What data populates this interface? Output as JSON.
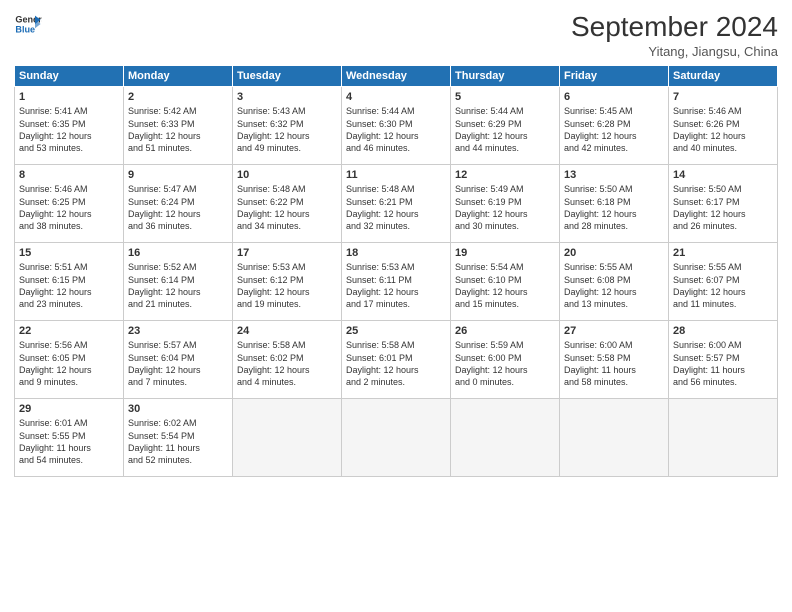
{
  "header": {
    "logo_line1": "General",
    "logo_line2": "Blue",
    "month": "September 2024",
    "location": "Yitang, Jiangsu, China"
  },
  "days_of_week": [
    "Sunday",
    "Monday",
    "Tuesday",
    "Wednesday",
    "Thursday",
    "Friday",
    "Saturday"
  ],
  "weeks": [
    [
      {
        "day": "1",
        "lines": [
          "Sunrise: 5:41 AM",
          "Sunset: 6:35 PM",
          "Daylight: 12 hours",
          "and 53 minutes."
        ]
      },
      {
        "day": "2",
        "lines": [
          "Sunrise: 5:42 AM",
          "Sunset: 6:33 PM",
          "Daylight: 12 hours",
          "and 51 minutes."
        ]
      },
      {
        "day": "3",
        "lines": [
          "Sunrise: 5:43 AM",
          "Sunset: 6:32 PM",
          "Daylight: 12 hours",
          "and 49 minutes."
        ]
      },
      {
        "day": "4",
        "lines": [
          "Sunrise: 5:44 AM",
          "Sunset: 6:30 PM",
          "Daylight: 12 hours",
          "and 46 minutes."
        ]
      },
      {
        "day": "5",
        "lines": [
          "Sunrise: 5:44 AM",
          "Sunset: 6:29 PM",
          "Daylight: 12 hours",
          "and 44 minutes."
        ]
      },
      {
        "day": "6",
        "lines": [
          "Sunrise: 5:45 AM",
          "Sunset: 6:28 PM",
          "Daylight: 12 hours",
          "and 42 minutes."
        ]
      },
      {
        "day": "7",
        "lines": [
          "Sunrise: 5:46 AM",
          "Sunset: 6:26 PM",
          "Daylight: 12 hours",
          "and 40 minutes."
        ]
      }
    ],
    [
      {
        "day": "8",
        "lines": [
          "Sunrise: 5:46 AM",
          "Sunset: 6:25 PM",
          "Daylight: 12 hours",
          "and 38 minutes."
        ]
      },
      {
        "day": "9",
        "lines": [
          "Sunrise: 5:47 AM",
          "Sunset: 6:24 PM",
          "Daylight: 12 hours",
          "and 36 minutes."
        ]
      },
      {
        "day": "10",
        "lines": [
          "Sunrise: 5:48 AM",
          "Sunset: 6:22 PM",
          "Daylight: 12 hours",
          "and 34 minutes."
        ]
      },
      {
        "day": "11",
        "lines": [
          "Sunrise: 5:48 AM",
          "Sunset: 6:21 PM",
          "Daylight: 12 hours",
          "and 32 minutes."
        ]
      },
      {
        "day": "12",
        "lines": [
          "Sunrise: 5:49 AM",
          "Sunset: 6:19 PM",
          "Daylight: 12 hours",
          "and 30 minutes."
        ]
      },
      {
        "day": "13",
        "lines": [
          "Sunrise: 5:50 AM",
          "Sunset: 6:18 PM",
          "Daylight: 12 hours",
          "and 28 minutes."
        ]
      },
      {
        "day": "14",
        "lines": [
          "Sunrise: 5:50 AM",
          "Sunset: 6:17 PM",
          "Daylight: 12 hours",
          "and 26 minutes."
        ]
      }
    ],
    [
      {
        "day": "15",
        "lines": [
          "Sunrise: 5:51 AM",
          "Sunset: 6:15 PM",
          "Daylight: 12 hours",
          "and 23 minutes."
        ]
      },
      {
        "day": "16",
        "lines": [
          "Sunrise: 5:52 AM",
          "Sunset: 6:14 PM",
          "Daylight: 12 hours",
          "and 21 minutes."
        ]
      },
      {
        "day": "17",
        "lines": [
          "Sunrise: 5:53 AM",
          "Sunset: 6:12 PM",
          "Daylight: 12 hours",
          "and 19 minutes."
        ]
      },
      {
        "day": "18",
        "lines": [
          "Sunrise: 5:53 AM",
          "Sunset: 6:11 PM",
          "Daylight: 12 hours",
          "and 17 minutes."
        ]
      },
      {
        "day": "19",
        "lines": [
          "Sunrise: 5:54 AM",
          "Sunset: 6:10 PM",
          "Daylight: 12 hours",
          "and 15 minutes."
        ]
      },
      {
        "day": "20",
        "lines": [
          "Sunrise: 5:55 AM",
          "Sunset: 6:08 PM",
          "Daylight: 12 hours",
          "and 13 minutes."
        ]
      },
      {
        "day": "21",
        "lines": [
          "Sunrise: 5:55 AM",
          "Sunset: 6:07 PM",
          "Daylight: 12 hours",
          "and 11 minutes."
        ]
      }
    ],
    [
      {
        "day": "22",
        "lines": [
          "Sunrise: 5:56 AM",
          "Sunset: 6:05 PM",
          "Daylight: 12 hours",
          "and 9 minutes."
        ]
      },
      {
        "day": "23",
        "lines": [
          "Sunrise: 5:57 AM",
          "Sunset: 6:04 PM",
          "Daylight: 12 hours",
          "and 7 minutes."
        ]
      },
      {
        "day": "24",
        "lines": [
          "Sunrise: 5:58 AM",
          "Sunset: 6:02 PM",
          "Daylight: 12 hours",
          "and 4 minutes."
        ]
      },
      {
        "day": "25",
        "lines": [
          "Sunrise: 5:58 AM",
          "Sunset: 6:01 PM",
          "Daylight: 12 hours",
          "and 2 minutes."
        ]
      },
      {
        "day": "26",
        "lines": [
          "Sunrise: 5:59 AM",
          "Sunset: 6:00 PM",
          "Daylight: 12 hours",
          "and 0 minutes."
        ]
      },
      {
        "day": "27",
        "lines": [
          "Sunrise: 6:00 AM",
          "Sunset: 5:58 PM",
          "Daylight: 11 hours",
          "and 58 minutes."
        ]
      },
      {
        "day": "28",
        "lines": [
          "Sunrise: 6:00 AM",
          "Sunset: 5:57 PM",
          "Daylight: 11 hours",
          "and 56 minutes."
        ]
      }
    ],
    [
      {
        "day": "29",
        "lines": [
          "Sunrise: 6:01 AM",
          "Sunset: 5:55 PM",
          "Daylight: 11 hours",
          "and 54 minutes."
        ]
      },
      {
        "day": "30",
        "lines": [
          "Sunrise: 6:02 AM",
          "Sunset: 5:54 PM",
          "Daylight: 11 hours",
          "and 52 minutes."
        ]
      },
      null,
      null,
      null,
      null,
      null
    ]
  ]
}
